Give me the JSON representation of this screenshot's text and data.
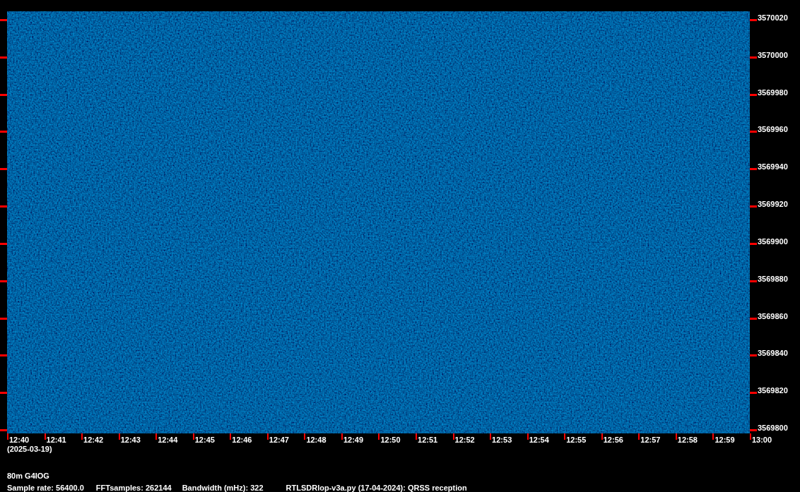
{
  "frequency_axis": [
    "3570020",
    "3570000",
    "3569980",
    "3569960",
    "3569940",
    "3569920",
    "3569900",
    "3569880",
    "3569860",
    "3569840",
    "3569820",
    "3569800"
  ],
  "time_axis": [
    "12:40",
    "12:41",
    "12:42",
    "12:43",
    "12:44",
    "12:45",
    "12:46",
    "12:47",
    "12:48",
    "12:49",
    "12:50",
    "12:51",
    "12:52",
    "12:53",
    "12:54",
    "12:55",
    "12:56",
    "12:57",
    "12:58",
    "12:59",
    "13:00"
  ],
  "date": "(2025-03-19)",
  "title": "80m G4IOG",
  "info": [
    "Sample rate: 56400.0",
    "FFTsamples: 262144",
    "Bandwidth (mHz): 322",
    "RTLSDRlop-v3a.py (17-04-2024): QRSS reception"
  ]
}
